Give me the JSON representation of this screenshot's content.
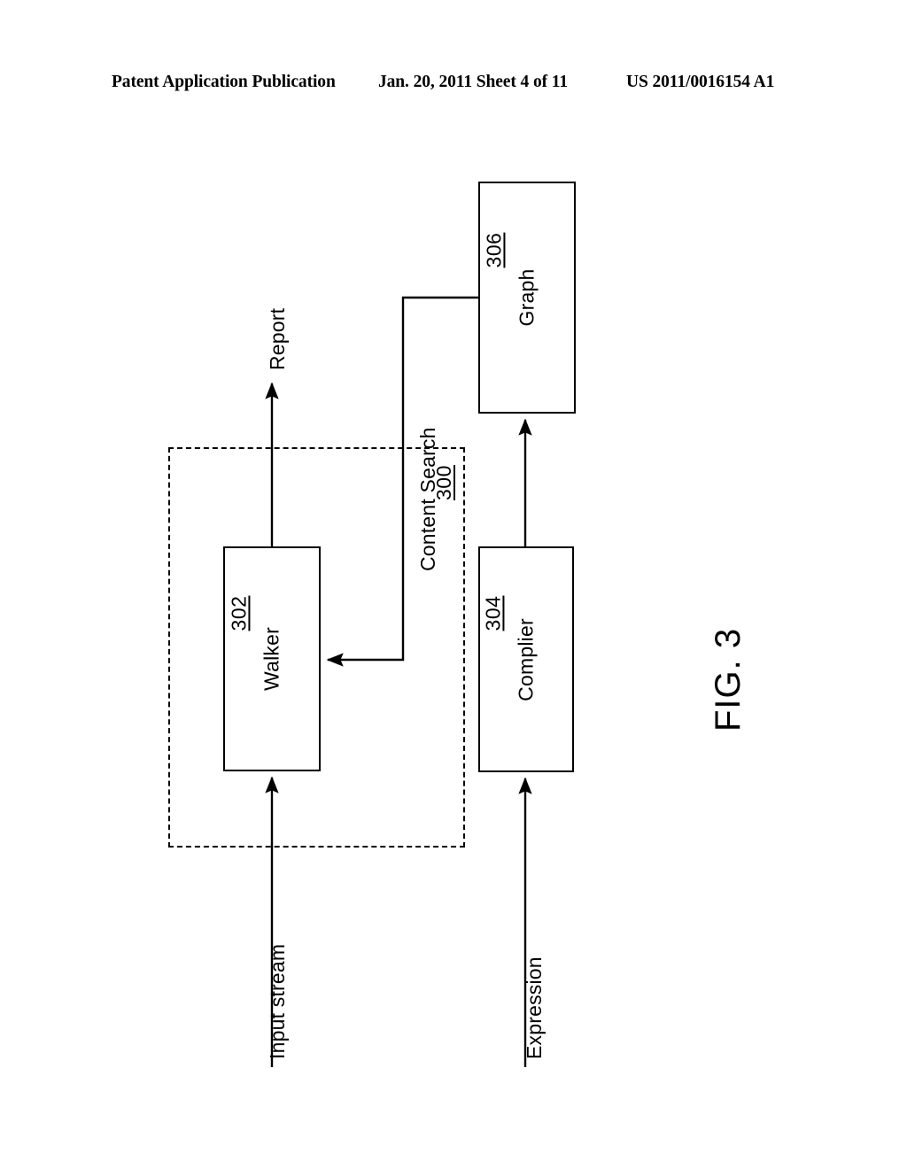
{
  "header": {
    "publication": "Patent Application Publication",
    "date_sheet": "Jan. 20, 2011  Sheet 4 of 11",
    "patent_number": "US 2011/0016154 A1"
  },
  "figure": {
    "caption": "FIG. 3",
    "group": {
      "label": "Content Search",
      "ref": "300"
    },
    "nodes": [
      {
        "id": "walker",
        "label": "Walker",
        "ref": "302"
      },
      {
        "id": "complier",
        "label": "Complier",
        "ref": "304"
      },
      {
        "id": "graph",
        "label": "Graph",
        "ref": "306"
      }
    ],
    "flows": [
      {
        "id": "report",
        "label": "Report"
      },
      {
        "id": "input-stream",
        "label": "Input stream"
      },
      {
        "id": "expression",
        "label": "Expression"
      }
    ]
  },
  "colors": {
    "ink": "#000000",
    "paper": "#ffffff"
  }
}
